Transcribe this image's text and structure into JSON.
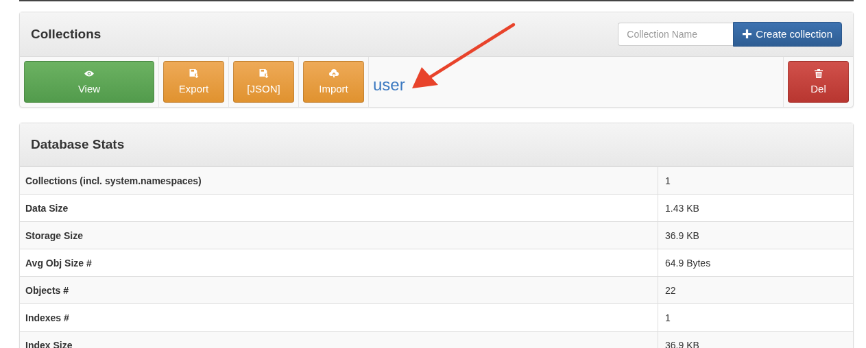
{
  "collections_panel": {
    "title": "Collections",
    "name_field": {
      "placeholder": "Collection Name"
    },
    "create_button": {
      "label": "Create collection"
    },
    "actions": [
      {
        "label": "View",
        "kind": "view"
      },
      {
        "label": "Export",
        "kind": "export"
      },
      {
        "label": "[JSON]",
        "kind": "json"
      },
      {
        "label": "Import",
        "kind": "import"
      }
    ],
    "collection_name": "user",
    "delete_button": {
      "label": "Del"
    }
  },
  "stats_panel": {
    "title": "Database Stats",
    "rows": [
      {
        "label": "Collections (incl. system.namespaces)",
        "value": "1"
      },
      {
        "label": "Data Size",
        "value": "1.43 KB"
      },
      {
        "label": "Storage Size",
        "value": "36.9 KB"
      },
      {
        "label": "Avg Obj Size #",
        "value": "64.9 Bytes"
      },
      {
        "label": "Objects #",
        "value": "22"
      },
      {
        "label": "Indexes #",
        "value": "1"
      },
      {
        "label": "Index Size",
        "value": "36.9 KB"
      }
    ]
  }
}
